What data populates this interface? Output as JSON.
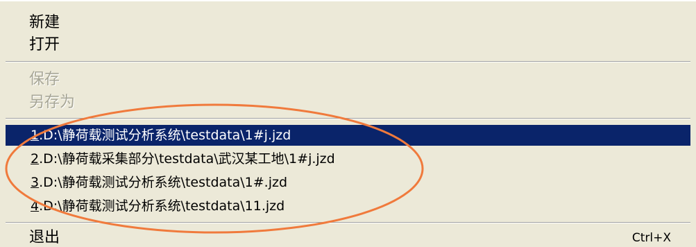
{
  "menu": {
    "new_label": "新建",
    "open_label": "打开",
    "save_label": "保存",
    "save_as_label": "另存为",
    "recent": [
      {
        "num": "1",
        "path": ".D:\\静荷载测试分析系统\\testdata\\1#j.jzd"
      },
      {
        "num": "2",
        "path": ".D:\\静荷载采集部分\\testdata\\武汉某工地\\1#j.jzd"
      },
      {
        "num": "3",
        "path": ".D:\\静荷载测试分析系统\\testdata\\1#.jzd"
      },
      {
        "num": "4",
        "path": ".D:\\静荷载测试分析系统\\testdata\\11.jzd"
      }
    ],
    "exit_label": "退出",
    "exit_shortcut": "Ctrl+X"
  },
  "colors": {
    "menu_bg": "#ece9d8",
    "highlight": "#0a246a",
    "disabled_text": "#a7a696",
    "annotation_ring": "#f07a3c"
  },
  "annotation": {
    "shape": "ellipse",
    "encircles": "recent-files-list"
  }
}
